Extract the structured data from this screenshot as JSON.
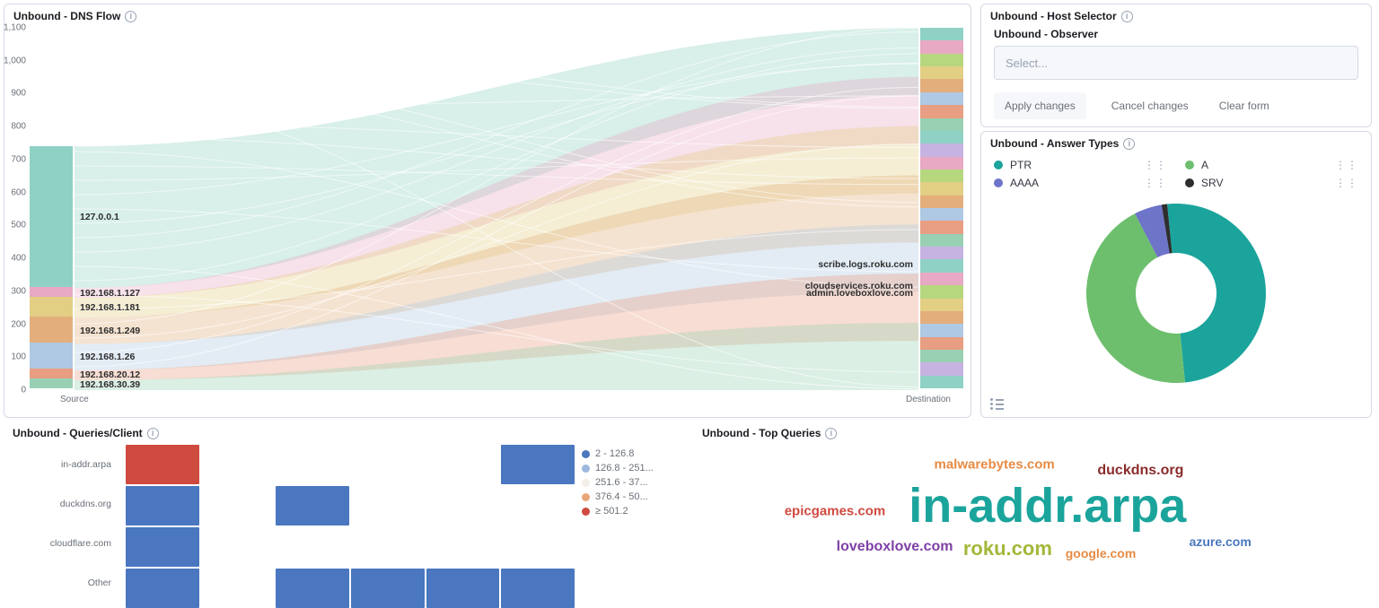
{
  "panels": {
    "dnsflow": {
      "title": "Unbound - DNS Flow",
      "x_source": "Source",
      "x_dest": "Destination"
    },
    "host": {
      "title": "Unbound - Host Selector",
      "form_label": "Unbound - Observer",
      "placeholder": "Select...",
      "apply": "Apply changes",
      "cancel": "Cancel changes",
      "clear": "Clear form"
    },
    "answers": {
      "title": "Unbound - Answer Types"
    },
    "qpc": {
      "title": "Unbound - Queries/Client"
    },
    "topq": {
      "title": "Unbound - Top Queries"
    }
  },
  "chart_data": [
    {
      "id": "dnsflow",
      "type": "sankey",
      "title": "Unbound - DNS Flow",
      "y_ticks": [
        0,
        100,
        200,
        300,
        400,
        500,
        600,
        700,
        800,
        900,
        1000,
        1100
      ],
      "ylim": [
        0,
        1100
      ],
      "stages": [
        "Source",
        "Destination"
      ],
      "sources": [
        {
          "name": "127.0.0.1",
          "value": 430,
          "color": "#8fd1c4"
        },
        {
          "name": "192.168.1.127",
          "value": 30,
          "color": "#e7a9c3"
        },
        {
          "name": "192.168.1.181",
          "value": 60,
          "color": "#e2cf84"
        },
        {
          "name": "192.168.1.249",
          "value": 80,
          "color": "#e3ae7c"
        },
        {
          "name": "192.168.1.26",
          "value": 80,
          "color": "#afc8e3"
        },
        {
          "name": "192.168.20.12",
          "value": 30,
          "color": "#e89e82"
        },
        {
          "name": "192.168.30.39",
          "value": 30,
          "color": "#99d0b3"
        }
      ],
      "labeled_destinations": [
        {
          "name": "admin.loveboxlove.com",
          "y": 295,
          "color": "#e7a9c3"
        },
        {
          "name": "cloudservices.roku.com",
          "y": 317,
          "color": "#e2cf84"
        },
        {
          "name": "scribe.logs.roku.com",
          "y": 380,
          "color": "#e3ae7c"
        }
      ],
      "destination_band_colors": [
        "#8fd1c4",
        "#e7a9c3",
        "#b7d77f",
        "#e2cf84",
        "#e3ae7c",
        "#afc8e3",
        "#e89e82",
        "#99d0b3",
        "#8fd1c4",
        "#c7b3e2",
        "#e7a9c3",
        "#b7d77f",
        "#e2cf84",
        "#e3ae7c",
        "#afc8e3",
        "#e89e82",
        "#99d0b3",
        "#c7b3e2",
        "#8fd1c4",
        "#e7a9c3",
        "#b7d77f",
        "#e2cf84",
        "#e3ae7c",
        "#afc8e3",
        "#e89e82",
        "#99d0b3",
        "#c7b3e2",
        "#8fd1c4"
      ]
    },
    {
      "id": "answer_types",
      "type": "pie",
      "title": "Unbound - Answer Types",
      "series": [
        {
          "name": "PTR",
          "value": 50,
          "color": "#1ba49c"
        },
        {
          "name": "A",
          "value": 44,
          "color": "#6dbf6d"
        },
        {
          "name": "AAAA",
          "value": 5,
          "color": "#6e74c8"
        },
        {
          "name": "SRV",
          "value": 1,
          "color": "#2e2e2e"
        }
      ]
    },
    {
      "id": "queries_per_client",
      "type": "heatmap",
      "title": "Unbound - Queries/Client",
      "y_categories": [
        "in-addr.arpa",
        "duckdns.org",
        "cloudflare.com",
        "Other"
      ],
      "x_bins": 6,
      "legend_bins": [
        {
          "label": "2 - 126.8",
          "color": "#4a77bf"
        },
        {
          "label": "126.8 - 251...",
          "color": "#9bb8dd"
        },
        {
          "label": "251.6 - 37...",
          "color": "#f4eee8"
        },
        {
          "label": "376.4 - 50...",
          "color": "#e9a779"
        },
        {
          "label": "≥ 501.2",
          "color": "#cf4a3f"
        }
      ],
      "cells": [
        {
          "row": "in-addr.arpa",
          "col": 0,
          "bin": 4
        },
        {
          "row": "in-addr.arpa",
          "col": 5,
          "bin": 0
        },
        {
          "row": "duckdns.org",
          "col": 0,
          "bin": 0
        },
        {
          "row": "duckdns.org",
          "col": 2,
          "bin": 0
        },
        {
          "row": "cloudflare.com",
          "col": 0,
          "bin": 0
        },
        {
          "row": "Other",
          "col": 0,
          "bin": 0
        },
        {
          "row": "Other",
          "col": 2,
          "bin": 0
        },
        {
          "row": "Other",
          "col": 3,
          "bin": 0
        },
        {
          "row": "Other",
          "col": 4,
          "bin": 0
        },
        {
          "row": "Other",
          "col": 5,
          "bin": 0
        }
      ]
    },
    {
      "id": "top_queries",
      "type": "wordcloud",
      "title": "Unbound - Top Queries",
      "words": [
        {
          "text": "in-addr.arpa",
          "weight": 100,
          "color": "#1ba49c"
        },
        {
          "text": "roku.com",
          "weight": 45,
          "color": "#a3b83a"
        },
        {
          "text": "loveboxlove.com",
          "weight": 32,
          "color": "#7e3fa5"
        },
        {
          "text": "duckdns.org",
          "weight": 30,
          "color": "#8a2c2c"
        },
        {
          "text": "malwarebytes.com",
          "weight": 28,
          "color": "#e78b44"
        },
        {
          "text": "epicgames.com",
          "weight": 26,
          "color": "#cf4a3f"
        },
        {
          "text": "google.com",
          "weight": 24,
          "color": "#e78b44"
        },
        {
          "text": "azure.com",
          "weight": 22,
          "color": "#4a77bf"
        }
      ]
    }
  ]
}
